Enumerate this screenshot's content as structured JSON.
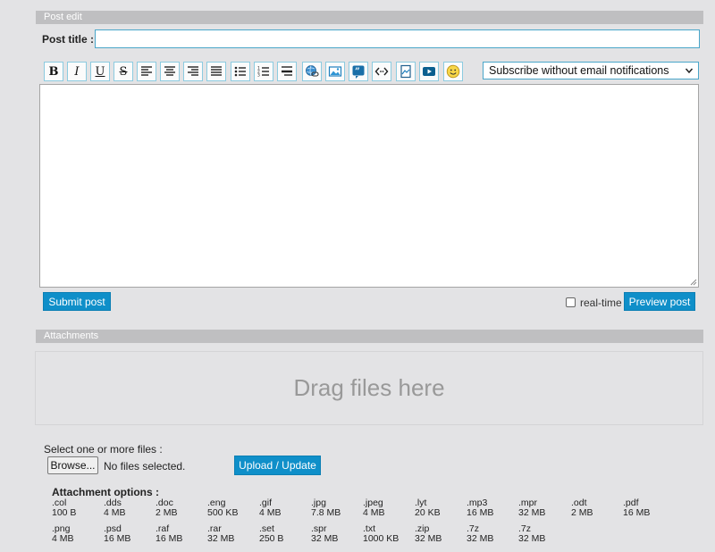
{
  "post_edit": {
    "section_title": "Post edit",
    "title_label": "Post title :",
    "title_value": "",
    "title_placeholder": ""
  },
  "toolbar": {
    "buttons": [
      {
        "name": "bold",
        "label": "B",
        "icon": "bold-icon"
      },
      {
        "name": "italic",
        "label": "I",
        "icon": "italic-icon"
      },
      {
        "name": "underline",
        "label": "U",
        "icon": "underline-icon"
      },
      {
        "name": "strike",
        "label": "S",
        "icon": "strikethrough-icon"
      },
      {
        "name": "align-left",
        "icon": "align-left-icon"
      },
      {
        "name": "align-center",
        "icon": "align-center-icon"
      },
      {
        "name": "align-right",
        "icon": "align-right-icon"
      },
      {
        "name": "justify",
        "icon": "align-justify-icon"
      },
      {
        "name": "bullet-list",
        "icon": "bullet-list-icon"
      },
      {
        "name": "numbered-list",
        "icon": "numbered-list-icon"
      },
      {
        "name": "hr",
        "icon": "horizontal-rule-icon"
      },
      {
        "name": "link",
        "icon": "link-globe-icon"
      },
      {
        "name": "image",
        "icon": "image-icon"
      },
      {
        "name": "quote",
        "icon": "quote-icon"
      },
      {
        "name": "code",
        "icon": "code-icon"
      },
      {
        "name": "spoiler",
        "icon": "hidden-doc-icon"
      },
      {
        "name": "video",
        "icon": "youtube-icon"
      },
      {
        "name": "smiley",
        "icon": "smiley-icon"
      }
    ],
    "subscribe_value": "Subscribe without email notifications"
  },
  "editor": {
    "content": ""
  },
  "actions": {
    "submit_label": "Submit post",
    "realtime_label": "real-time",
    "realtime_checked": false,
    "preview_label": "Preview post"
  },
  "attachments": {
    "section_title": "Attachments",
    "dropzone_text": "Drag files here",
    "select_label": "Select one or more files :",
    "browse_label": "Browse...",
    "no_files_label": "No files selected.",
    "upload_label": "Upload / Update",
    "options_label": "Attachment options :",
    "options": [
      {
        "ext": ".col",
        "size": "100 B"
      },
      {
        "ext": ".dds",
        "size": "4 MB"
      },
      {
        "ext": ".doc",
        "size": "2 MB"
      },
      {
        "ext": ".eng",
        "size": "500 KB"
      },
      {
        "ext": ".gif",
        "size": "4 MB"
      },
      {
        "ext": ".jpg",
        "size": "7.8 MB"
      },
      {
        "ext": ".jpeg",
        "size": "4 MB"
      },
      {
        "ext": ".lyt",
        "size": "20 KB"
      },
      {
        "ext": ".mp3",
        "size": "16 MB"
      },
      {
        "ext": ".mpr",
        "size": "32 MB"
      },
      {
        "ext": ".odt",
        "size": "2 MB"
      },
      {
        "ext": ".pdf",
        "size": "16 MB"
      },
      {
        "ext": ".png",
        "size": "4 MB"
      },
      {
        "ext": ".psd",
        "size": "16 MB"
      },
      {
        "ext": ".raf",
        "size": "16 MB"
      },
      {
        "ext": ".rar",
        "size": "32 MB"
      },
      {
        "ext": ".set",
        "size": "250 B"
      },
      {
        "ext": ".spr",
        "size": "32 MB"
      },
      {
        "ext": ".txt",
        "size": "1000 KB"
      },
      {
        "ext": ".zip",
        "size": "32 MB"
      },
      {
        "ext": ".7z",
        "size": "32 MB"
      },
      {
        "ext": ".7z",
        "size": "32 MB"
      }
    ]
  },
  "colors": {
    "accent": "#0f8fc9",
    "section_bar": "#bfbfc1",
    "background": "#e3e3e5"
  }
}
